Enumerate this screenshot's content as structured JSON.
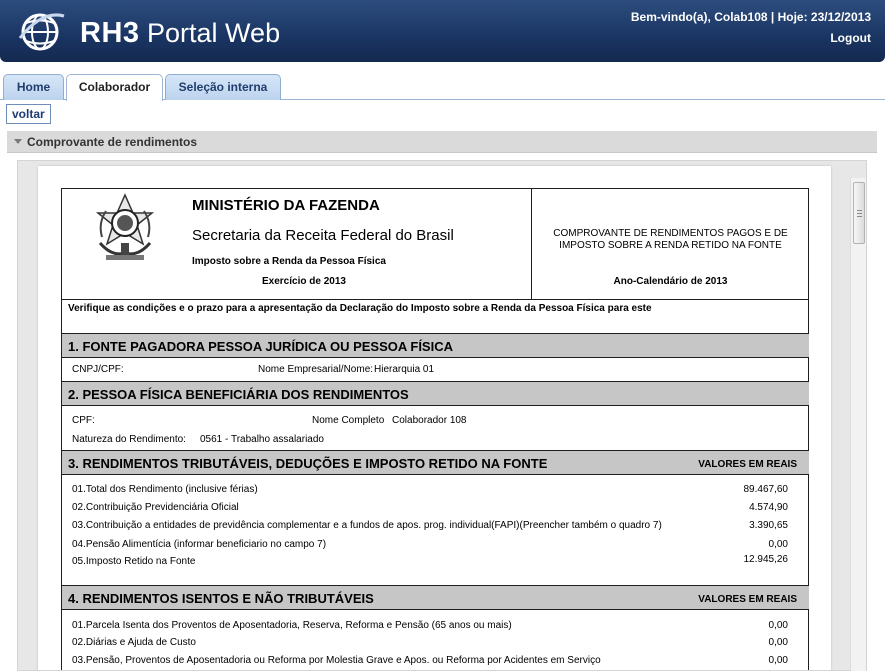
{
  "header": {
    "app_name_bold": "RH3",
    "app_name_rest": " Portal Web",
    "welcome_text": "Bem-vindo(a), Colab108 | Hoje: 23/12/2013",
    "logout_label": "Logout"
  },
  "tabs": [
    {
      "label": "Home"
    },
    {
      "label": "Colaborador"
    },
    {
      "label": "Seleção interna"
    }
  ],
  "voltar_label": "voltar",
  "section_title": "Comprovante de rendimentos",
  "document": {
    "ministry": "MINISTÉRIO DA FAZENDA",
    "secretaria": "Secretaria da Receita Federal do Brasil",
    "imposto": "Imposto sobre a Renda da Pessoa Física",
    "exercicio": "Exercício de 2013",
    "comprovante": "COMPROVANTE DE RENDIMENTOS PAGOS E DE IMPOSTO SOBRE A RENDA RETIDO NA FONTE",
    "ano": "Ano-Calendário de 2013",
    "verifique": "Verifique as condições e o prazo para a apresentação da Declaração do Imposto sobre a Renda da Pessoa Física para este",
    "s1": {
      "title": "1. FONTE PAGADORA PESSOA JURÍDICA OU PESSOA FÍSICA",
      "cnpj_label": "CNPJ/CPF:",
      "nome_label": "Nome Empresarial/Nome:",
      "nome_value": "Hierarquia 01"
    },
    "s2": {
      "title": "2. PESSOA FÍSICA BENEFICIÁRIA DOS RENDIMENTOS",
      "cpf_label": "CPF:",
      "nome_label": "Nome Completo",
      "nome_value": "Colaborador 108",
      "natureza_label": "Natureza do Rendimento:",
      "natureza_value": "0561 - Trabalho assalariado"
    },
    "s3": {
      "title": "3. RENDIMENTOS TRIBUTÁVEIS, DEDUÇÕES E IMPOSTO RETIDO NA FONTE",
      "valores_label": "VALORES EM REAIS",
      "items": [
        {
          "label": "01.Total dos Rendimento (inclusive férias)",
          "value": "89.467,60"
        },
        {
          "label": "02.Contribuição Previdenciária Oficial",
          "value": "4.574,90"
        },
        {
          "label": "03.Contribuição a entidades de previdência complementar e a fundos de apos. prog. individual(FAPI)(Preencher também o quadro 7)",
          "value": "3.390,65"
        },
        {
          "label": "04.Pensão Alimentícia (informar beneficiario no campo 7)",
          "value": "0,00"
        },
        {
          "label": "05.Imposto Retido na Fonte",
          "value": "12.945,26"
        }
      ]
    },
    "s4": {
      "title": "4. RENDIMENTOS ISENTOS E NÃO TRIBUTÁVEIS",
      "valores_label": "VALORES EM REAIS",
      "items": [
        {
          "label": "01.Parcela Isenta dos Proventos de Aposentadoria, Reserva, Reforma e Pensão  (65 anos ou mais)",
          "value": "0,00"
        },
        {
          "label": "02.Diárias e Ajuda de Custo",
          "value": "0,00"
        },
        {
          "label": "03.Pensão, Proventos de Aposentadoria ou Reforma por Molestia Grave e Apos. ou Reforma por Acidentes em Serviço",
          "value": "0,00"
        }
      ]
    }
  }
}
